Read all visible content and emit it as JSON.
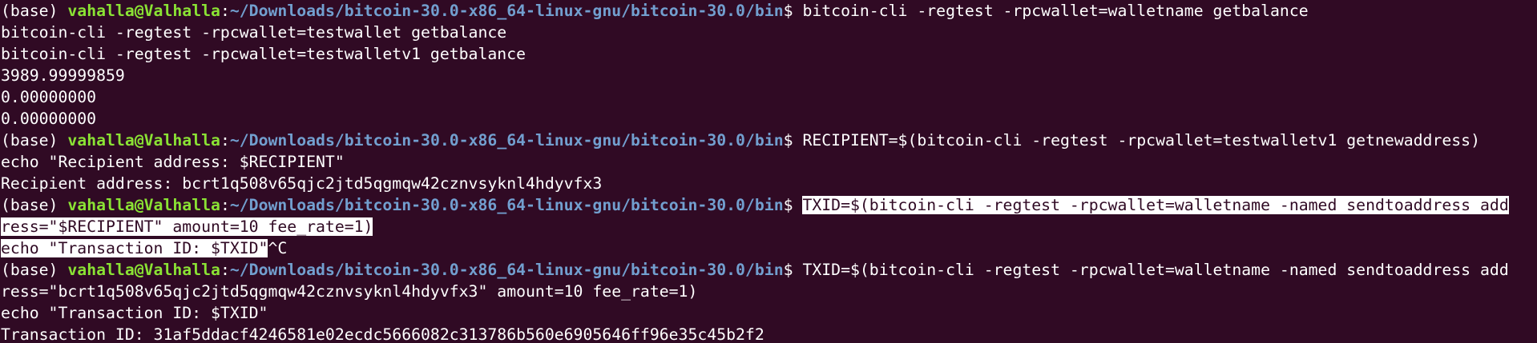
{
  "prompt": {
    "env": "(base) ",
    "user_host": "vahalla@Valhalla",
    "sep": ":",
    "path": "~/Downloads/bitcoin-30.0-x86_64-linux-gnu/bitcoin-30.0/bin",
    "dollar": "$ "
  },
  "lines": {
    "l1_cmd": "bitcoin-cli -regtest -rpcwallet=walletname getbalance",
    "l2": "bitcoin-cli -regtest -rpcwallet=testwallet getbalance",
    "l3": "bitcoin-cli -regtest -rpcwallet=testwalletv1 getbalance",
    "l4": "3989.99999859",
    "l5": "0.00000000",
    "l6": "0.00000000",
    "l7_cmd": "RECIPIENT=$(bitcoin-cli -regtest -rpcwallet=testwalletv1 getnewaddress)",
    "l8": "echo \"Recipient address: $RECIPIENT\"",
    "l9": "Recipient address: bcrt1q508v65qjc2jtd5qgmqw42cznvsyknl4hdyvfx3",
    "l10_cmd": "TXID=$(bitcoin-cli -regtest -rpcwallet=walletname -named sendtoaddress add",
    "l11": "ress=\"$RECIPIENT\" amount=10 fee_rate=1)",
    "l12_sel": "echo \"Transaction ID: $TXID\"",
    "l12_rest": "^C",
    "l13_cmd": "TXID=$(bitcoin-cli -regtest -rpcwallet=walletname -named sendtoaddress add",
    "l14": "ress=\"bcrt1q508v65qjc2jtd5qgmqw42cznvsyknl4hdyvfx3\" amount=10 fee_rate=1)",
    "l15": "echo \"Transaction ID: $TXID\"",
    "l16": "Transaction ID: 31af5ddacf4246581e02ecdc5666082c313786b560e6905646ff96e35c45b2f2"
  },
  "colors": {
    "background": "#300a24",
    "text": "#ffffff",
    "user_host": "#8ae234",
    "path": "#729fcf",
    "selection_bg": "#ffffff",
    "selection_fg": "#300a24"
  }
}
